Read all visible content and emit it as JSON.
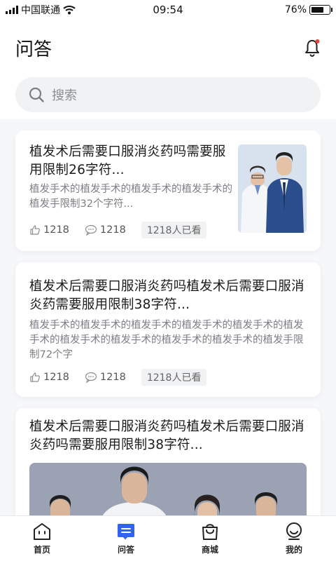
{
  "status_bar": {
    "carrier": "中国联通",
    "time": "09:54",
    "battery": "76%",
    "battery_level": 0.76
  },
  "header": {
    "title": "问答",
    "notification_dot_color": "#e8423b"
  },
  "search": {
    "placeholder": "搜索"
  },
  "accent_color": "#2f63f0",
  "questions": [
    {
      "title": "植发术后需要口服消炎药吗需要服用限制26字符...",
      "summary": "植发手术的植发手术的植发手术的植发手术的植发手限制32个字符...",
      "likes": "1218",
      "comments": "1218",
      "views": "1218人已看",
      "image": "doctors-photo"
    },
    {
      "title": "植发术后需要口服消炎药吗植发术后需要口服消炎药需要服用限制38字符...",
      "summary": "植发手术的植发手术的植发手术的植发手术的植发手术的植发手术的植发手术的植发手术的植发手术的植发手术的植发手限制72个字",
      "likes": "1218",
      "comments": "1218",
      "views": "1218人已看"
    },
    {
      "title": "植发术后需要口服消炎药吗植发术后需要口服消炎药吗需要服用限制38字符...",
      "image": "team-photo"
    }
  ],
  "tabbar": {
    "tabs": [
      {
        "label": "首页",
        "icon": "home-icon",
        "active": false
      },
      {
        "label": "问答",
        "icon": "qa-icon",
        "active": true
      },
      {
        "label": "商城",
        "icon": "shop-icon",
        "active": false
      },
      {
        "label": "我的",
        "icon": "profile-icon",
        "active": false
      }
    ]
  }
}
